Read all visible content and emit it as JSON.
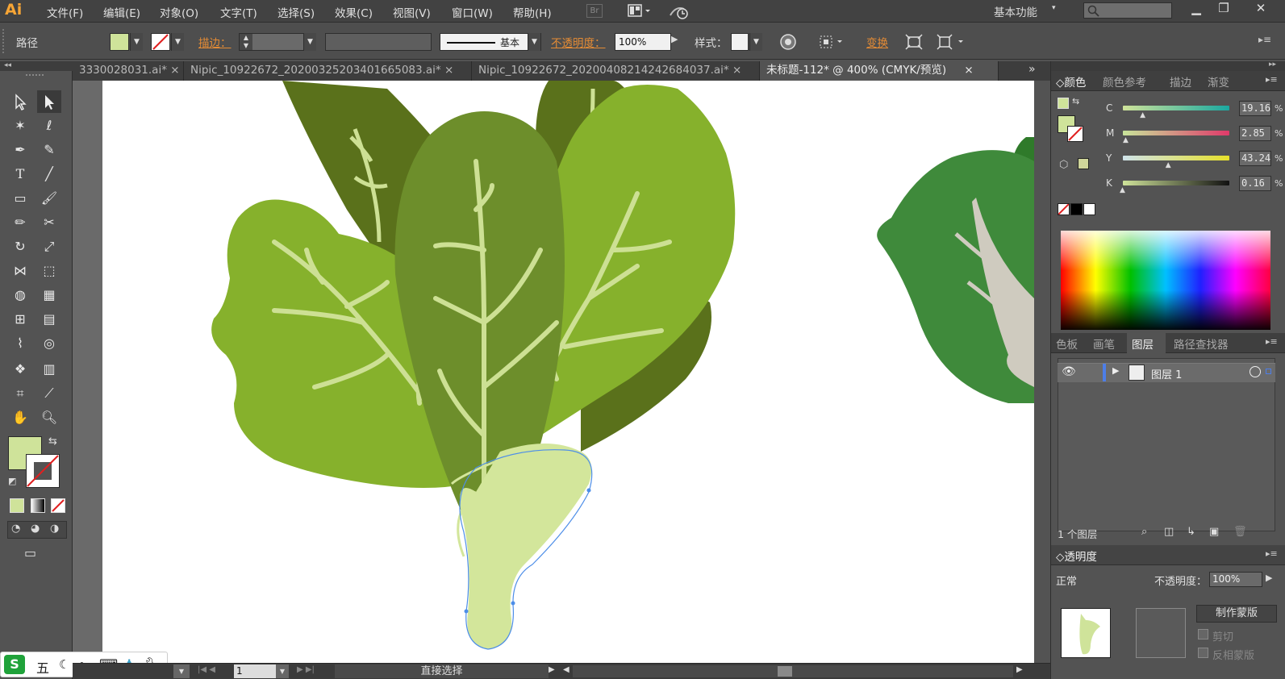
{
  "app": {
    "logo": "Ai"
  },
  "menu": {
    "items": [
      "文件(F)",
      "编辑(E)",
      "对象(O)",
      "文字(T)",
      "选择(S)",
      "效果(C)",
      "视图(V)",
      "窗口(W)",
      "帮助(H)"
    ],
    "bridge_label": "Br",
    "workspace": "基本功能"
  },
  "control": {
    "object_type": "路径",
    "stroke_label": "描边：",
    "stroke_profile": "基本",
    "opacity_label": "不透明度：",
    "opacity_value": "100%",
    "style_label": "样式：",
    "transform_label": "变换",
    "fill_color": "#cfe39a"
  },
  "tabs": [
    {
      "label": "3330028031.ai*",
      "active": false
    },
    {
      "label": "Nipic_10922672_20200325203401665083.ai*",
      "active": false
    },
    {
      "label": "Nipic_10922672_20200408214242684037.ai*",
      "active": false
    },
    {
      "label": "未标题-112* @ 400% (CMYK/预览)",
      "active": true
    }
  ],
  "tab_close": "×",
  "tab_overflow": "»",
  "statusbar": {
    "page": "1",
    "tool": "直接选择"
  },
  "panels": {
    "color": {
      "tabs": [
        "颜色",
        "颜色参考",
        "描边",
        "渐变"
      ],
      "channels": [
        {
          "label": "C",
          "value": "19.16",
          "fraction": 0.19
        },
        {
          "label": "M",
          "value": "2.85",
          "fraction": 0.03
        },
        {
          "label": "Y",
          "value": "43.24",
          "fraction": 0.43
        },
        {
          "label": "K",
          "value": "0.16",
          "fraction": 0.0
        }
      ],
      "pct": "%"
    },
    "layers": {
      "tabs": [
        "色板",
        "画笔",
        "图层",
        "路径查找器"
      ],
      "layer_name": "图层 1",
      "count": "1 个图层"
    },
    "transparency": {
      "title": "透明度",
      "mode": "正常",
      "opacity_label": "不透明度：",
      "opacity_value": "100%",
      "make_mask": "制作蒙版",
      "clip": "剪切",
      "invert": "反相蒙版"
    }
  },
  "ime": {
    "label": "五"
  },
  "colors": {
    "leaf_light": "#86b12c",
    "leaf_mid": "#6d8e2b",
    "leaf_dark": "#5a711b",
    "vein": "#cde094",
    "stem": "#d3e69b",
    "bok_choy": "#3f8a3b"
  }
}
